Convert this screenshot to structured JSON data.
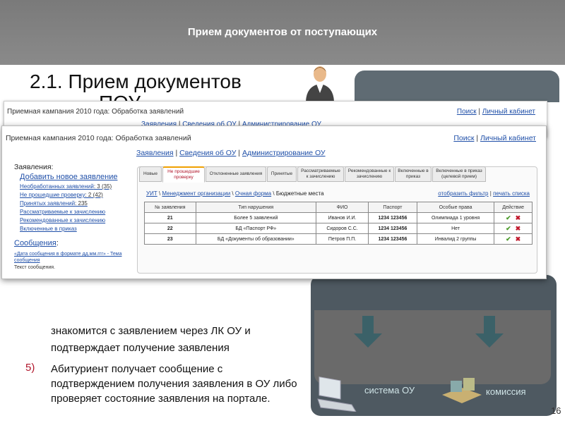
{
  "banner": {
    "title": "Прием документов от поступающих"
  },
  "slide": {
    "heading": "2.1. Прием документов",
    "heading_partial": "ПОУ",
    "step4_text": "знакомится с заявлением через ЛК ОУ и подтверждает получение заявления",
    "step5_number": "5)",
    "step5_text": "Абитуриент получает сообщение с подтверждением получения заявления в ОУ либо проверяет состояние заявления на портале.",
    "page_number": "16"
  },
  "diagram": {
    "system_label": "система ОУ",
    "commission_label": "комиссия"
  },
  "bg_window": {
    "title": "Приемная кампания 2010 года: Обработка заявлений",
    "links": [
      "Поиск",
      "Личный кабинет"
    ],
    "nav": [
      "Заявления",
      "Сведения об ОУ",
      "Администрирование ОУ"
    ]
  },
  "window": {
    "title": "Приемная кампания 2010 года: Обработка заявлений",
    "links": [
      "Поиск",
      "Личный кабинет"
    ],
    "nav": [
      "Заявления",
      "Сведения об ОУ",
      "Администрирование ОУ"
    ]
  },
  "sidebar": {
    "heading": "Заявления:",
    "add_new": "Добавить новое заявление",
    "items": [
      {
        "label": "Необработанных заявлений",
        "count": ": 3 (35)"
      },
      {
        "label": "Не прошедшие проверку",
        "count": ": 2 (42)"
      },
      {
        "label": "Принятых заявлений",
        "count": ": 235"
      },
      {
        "label": "Рассматриваемые к зачислению",
        "count": ""
      },
      {
        "label": "Рекомендованные к зачислению",
        "count": ""
      },
      {
        "label": "Включенные в приказ",
        "count": ""
      }
    ],
    "messages_heading": "Сообщения",
    "messages_colon": ":",
    "messages_sample": "«Дата сообщения в формате дд.мм.ггг» - Тема сообщения",
    "messages_text": "Текст сообщения."
  },
  "tabs": [
    "Новые",
    "Не прошедшие проверку",
    "Отклоненные заявления",
    "Принятые",
    "Рассматриваемые к зачислению",
    "Рекомендованные к зачислению",
    "Включенные в приказ",
    "Включенные в приказ (целевой прием)"
  ],
  "breadcrumb": [
    "УИТ",
    "Менеджмент организации",
    "Очная форма",
    "Бюджетные места"
  ],
  "content_actions": [
    "отобразить фильтр",
    "печать списка"
  ],
  "table": {
    "headers": [
      "№ заявления",
      "Тип нарушения",
      "ФИО",
      "Паспорт",
      "Особые права",
      "Действие"
    ],
    "rows": [
      {
        "num": "21",
        "violation": "Более 5 заявлений",
        "name": "Иванов И.И.",
        "passport": "1234 123456",
        "rights": "Олимпиада 1 уровня"
      },
      {
        "num": "22",
        "violation": "БД «Паспорт РФ»",
        "name": "Сидоров С.С.",
        "passport": "1234 123456",
        "rights": "Нет"
      },
      {
        "num": "23",
        "violation": "БД «Документы об образовании»",
        "name": "Петров П.П.",
        "passport": "1234 123456",
        "rights": "Инвалид 2 группы"
      }
    ]
  }
}
